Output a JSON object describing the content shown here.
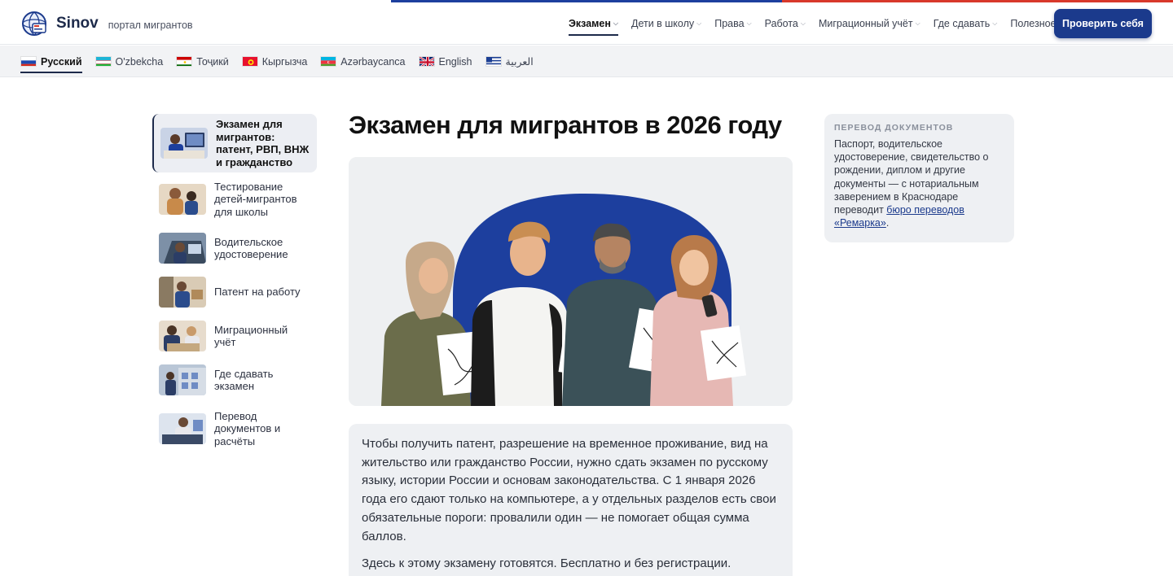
{
  "header": {
    "brand": "Sinov",
    "tagline": "портал мигрантов",
    "nav": [
      {
        "label": "Экзамен",
        "active": true
      },
      {
        "label": "Дети в школу",
        "active": false
      },
      {
        "label": "Права",
        "active": false
      },
      {
        "label": "Работа",
        "active": false
      },
      {
        "label": "Миграционный учёт",
        "active": false
      },
      {
        "label": "Где сдавать",
        "active": false
      },
      {
        "label": "Полезное",
        "active": false
      }
    ],
    "cta_label": "Проверить себя"
  },
  "languages": [
    {
      "label": "Русский",
      "flag": "ru-flag",
      "active": true
    },
    {
      "label": "O'zbekcha",
      "flag": "uz-flag",
      "active": false
    },
    {
      "label": "Тоҷикӣ",
      "flag": "tj-flag",
      "active": false
    },
    {
      "label": "Кыргызча",
      "flag": "kg-flag",
      "active": false
    },
    {
      "label": "Azərbaycanca",
      "flag": "az-flag",
      "active": false
    },
    {
      "label": "English",
      "flag": "gb-flag",
      "active": false
    },
    {
      "label": "العربية",
      "flag": "ar-flag",
      "active": false
    }
  ],
  "sidebar": {
    "items": [
      {
        "label": "Экзамен для мигрантов: патент, РВП, ВНЖ и гражданство",
        "active": true
      },
      {
        "label": "Тестирование детей-мигрантов для школы",
        "active": false
      },
      {
        "label": "Водительское удостоверение",
        "active": false
      },
      {
        "label": "Патент на работу",
        "active": false
      },
      {
        "label": "Миграционный учёт",
        "active": false
      },
      {
        "label": "Где сдавать экзамен",
        "active": false
      },
      {
        "label": "Перевод документов и расчёты",
        "active": false
      }
    ]
  },
  "main": {
    "title": "Экзамен для мигрантов в 2026 году",
    "intro_p1": "Чтобы получить патент, разрешение на временное проживание, вид на жительство или гражданство России, нужно сдать экзамен по русскому языку, истории России и основам законодательства. С 1 января 2026 года его сдают только на компьютере, а у отдельных разделов есть свои обязательные пороги: провалили один — не помогает общая сумма баллов.",
    "intro_p2": "Здесь к этому экзамену готовятся. Бесплатно и без регистрации."
  },
  "aside": {
    "title": "Перевод документов",
    "text": "Паспорт, водительское удостоверение, свидетельство о рождении, диплом и другие документы — с нотариальным заверением в Краснодаре переводит ",
    "link_label": "бюро переводов «Ремарка»",
    "text_end": "."
  },
  "colors": {
    "brand": "#1b3a8c",
    "hero_blob": "#1d3f9e",
    "stripe_blue": "#1d3f9e",
    "stripe_red": "#d8392b"
  }
}
